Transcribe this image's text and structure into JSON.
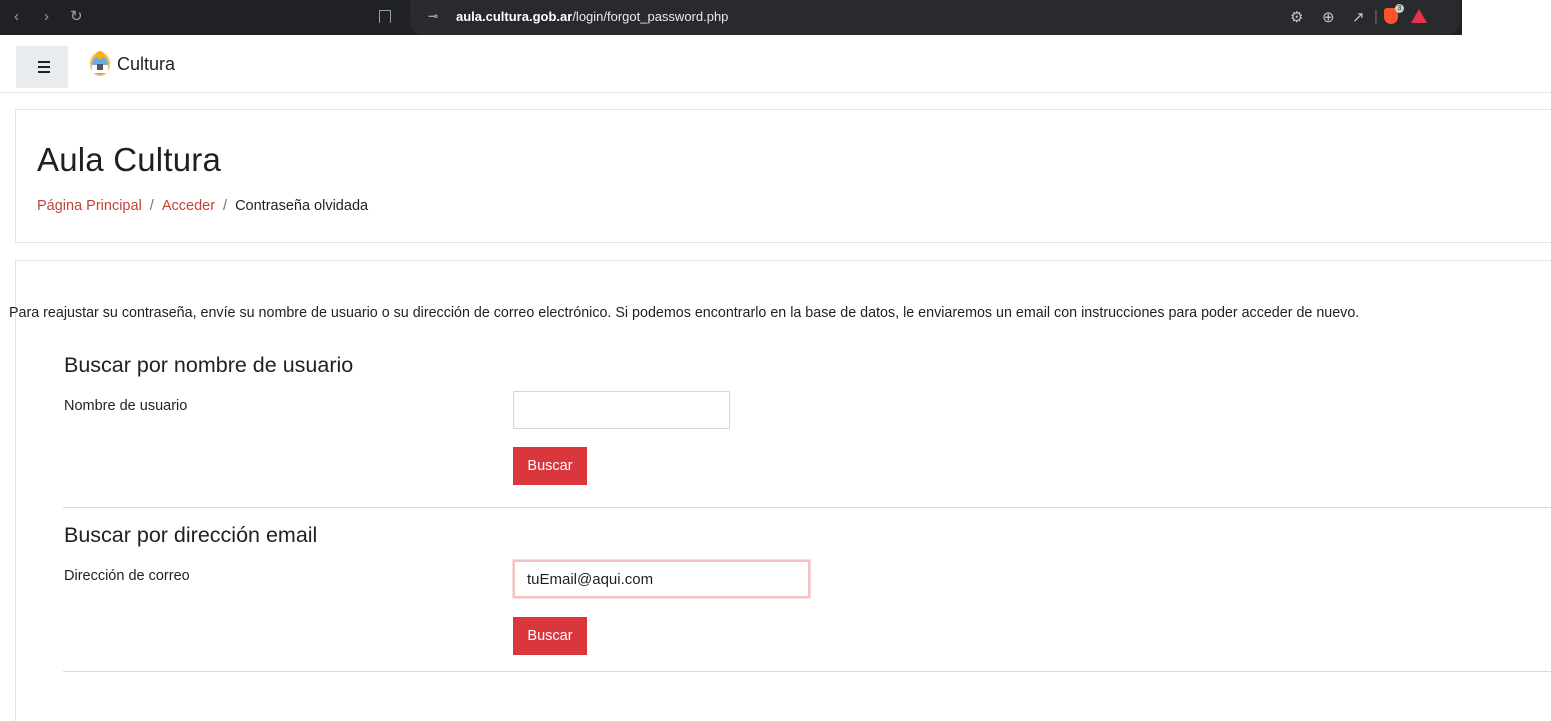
{
  "browser": {
    "url_host": "aula.cultura.gob.ar",
    "url_path": "/login/forgot_password.php",
    "extension_badge": "3"
  },
  "header": {
    "brand": "Cultura"
  },
  "page": {
    "title": "Aula Cultura",
    "breadcrumb": [
      {
        "label": "Página Principal"
      },
      {
        "label": "Acceder"
      },
      {
        "label": "Contraseña olvidada"
      }
    ],
    "separator": "/"
  },
  "form": {
    "intro": "Para reajustar su contraseña, envíe su nombre de usuario o su dirección de correo electrónico. Si podemos encontrarlo en la base de datos, le enviaremos un email con instrucciones para poder acceder de nuevo.",
    "username_section": {
      "heading": "Buscar por nombre de usuario",
      "label": "Nombre de usuario",
      "value": "",
      "button": "Buscar"
    },
    "email_section": {
      "heading": "Buscar por dirección email",
      "label": "Dirección de correo",
      "value": "tuEmail@aqui.com",
      "button": "Buscar"
    }
  },
  "colors": {
    "accent": "#d9363e",
    "link": "#c8403b",
    "browser_bar": "#202124"
  }
}
